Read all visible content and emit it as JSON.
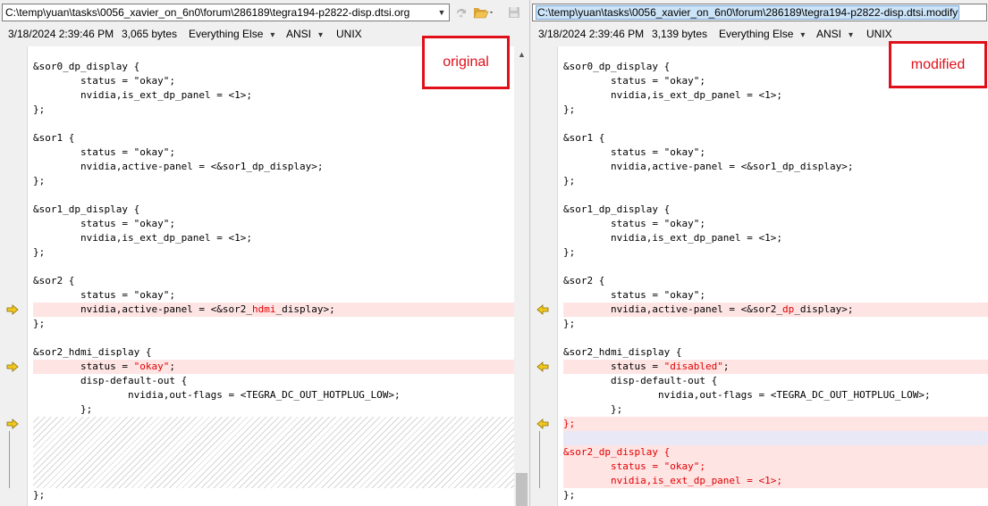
{
  "left": {
    "path": "C:\\temp\\yuan\\tasks\\0056_xavier_on_6n0\\forum\\286189\\tegra194-p2822-disp.dtsi.org",
    "date": "3/18/2024 2:39:46 PM",
    "size": "3,065 bytes",
    "filter": "Everything Else",
    "encoding": "ANSI",
    "eol": "UNIX",
    "callout": "original",
    "lines": [
      {
        "t": "&sor0_dp_display {"
      },
      {
        "t": "        status = \"okay\";"
      },
      {
        "t": "        nvidia,is_ext_dp_panel = <1>;"
      },
      {
        "t": "};"
      },
      {
        "t": ""
      },
      {
        "t": "&sor1 {"
      },
      {
        "t": "        status = \"okay\";"
      },
      {
        "t": "        nvidia,active-panel = <&sor1_dp_display>;"
      },
      {
        "t": "};"
      },
      {
        "t": ""
      },
      {
        "t": "&sor1_dp_display {"
      },
      {
        "t": "        status = \"okay\";"
      },
      {
        "t": "        nvidia,is_ext_dp_panel = <1>;"
      },
      {
        "t": "};"
      },
      {
        "t": ""
      },
      {
        "t": "&sor2 {"
      },
      {
        "t": "        status = \"okay\";"
      },
      {
        "pre": "        nvidia,active-panel = <&sor2_",
        "hl": "hdmi",
        "post": "_display>;",
        "diff": true
      },
      {
        "t": "};"
      },
      {
        "t": ""
      },
      {
        "t": "&sor2_hdmi_display {"
      },
      {
        "pre": "        status = ",
        "hl": "\"okay\"",
        "post": ";",
        "diff": true
      },
      {
        "t": "        disp-default-out {"
      },
      {
        "t": "                nvidia,out-flags = <TEGRA_DC_OUT_HOTPLUG_LOW>;"
      },
      {
        "t": "        };"
      }
    ],
    "last_line": "};"
  },
  "right": {
    "path": "C:\\temp\\yuan\\tasks\\0056_xavier_on_6n0\\forum\\286189\\tegra194-p2822-disp.dtsi.modify",
    "date": "3/18/2024 2:39:46 PM",
    "size": "3,139 bytes",
    "filter": "Everything Else",
    "encoding": "ANSI",
    "eol": "UNIX",
    "callout": "modified",
    "lines": [
      {
        "t": "&sor0_dp_display {"
      },
      {
        "t": "        status = \"okay\";"
      },
      {
        "t": "        nvidia,is_ext_dp_panel = <1>;"
      },
      {
        "t": "};"
      },
      {
        "t": ""
      },
      {
        "t": "&sor1 {"
      },
      {
        "t": "        status = \"okay\";"
      },
      {
        "t": "        nvidia,active-panel = <&sor1_dp_display>;"
      },
      {
        "t": "};"
      },
      {
        "t": ""
      },
      {
        "t": "&sor1_dp_display {"
      },
      {
        "t": "        status = \"okay\";"
      },
      {
        "t": "        nvidia,is_ext_dp_panel = <1>;"
      },
      {
        "t": "};"
      },
      {
        "t": ""
      },
      {
        "t": "&sor2 {"
      },
      {
        "t": "        status = \"okay\";"
      },
      {
        "pre": "        nvidia,active-panel = <&sor2_",
        "hl": "dp",
        "post": "_display>;",
        "diff": true
      },
      {
        "t": "};"
      },
      {
        "t": ""
      },
      {
        "t": "&sor2_hdmi_display {"
      },
      {
        "pre": "        status = ",
        "hl": "\"disabled\"",
        "post": ";",
        "diff": true
      },
      {
        "t": "        disp-default-out {"
      },
      {
        "t": "                nvidia,out-flags = <TEGRA_DC_OUT_HOTPLUG_LOW>;"
      },
      {
        "t": "        };"
      },
      {
        "t": "};",
        "diff": true,
        "red": true
      },
      {
        "t": "",
        "gap": true
      },
      {
        "t": "&sor2_dp_display {",
        "diff": true,
        "red": true
      },
      {
        "t": "        status = \"okay\";",
        "diff": true,
        "red": true
      },
      {
        "t": "        nvidia,is_ext_dp_panel = <1>;",
        "diff": true,
        "red": true
      },
      {
        "t": "};"
      }
    ]
  },
  "colors": {
    "accent_red": "#e0101a",
    "diff_bg": "#ffe4e4",
    "marker": "#f2c81e"
  },
  "icons": [
    "sync-icon",
    "open-folder-icon",
    "save-icon",
    "chevron-down-icon",
    "diff-arrow-icon"
  ]
}
